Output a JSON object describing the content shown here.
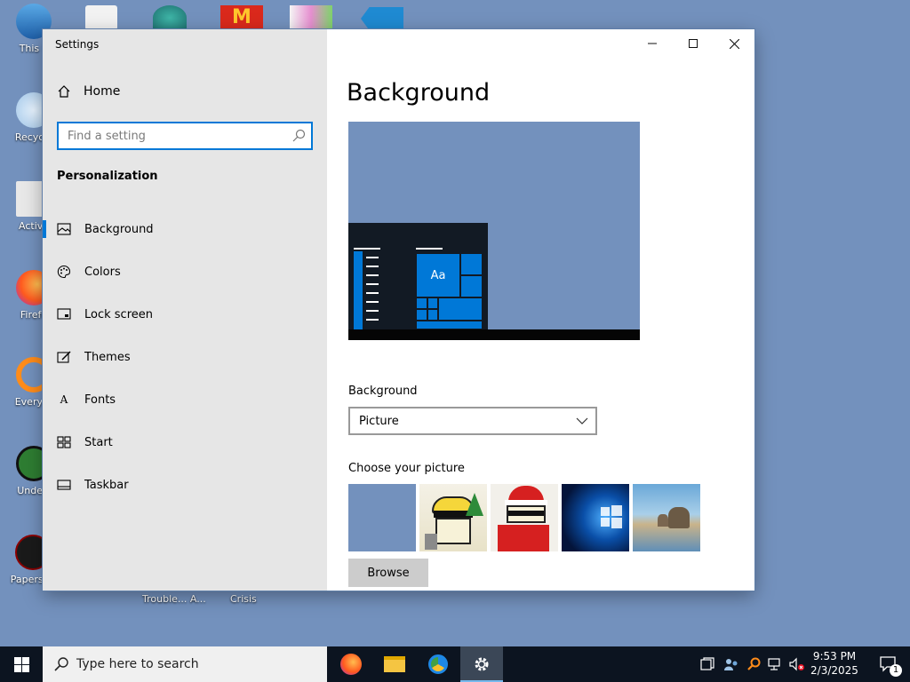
{
  "desktop": {
    "icons": [
      {
        "label": "This P"
      },
      {
        "label": "Recycle"
      },
      {
        "label": "Activa"
      },
      {
        "label": "Firefo"
      },
      {
        "label": "Everyth"
      },
      {
        "label": "Undert"
      },
      {
        "label": "Papers, P"
      }
    ],
    "labels_bottom": [
      "Trouble... A...",
      "Crisis"
    ]
  },
  "window": {
    "title": "Settings",
    "controls": {
      "minimize": "—",
      "maximize": "☐",
      "close": "✕"
    }
  },
  "sidebar": {
    "home_label": "Home",
    "search_placeholder": "Find a setting",
    "section_title": "Personalization",
    "items": [
      {
        "label": "Background",
        "icon": "picture-icon",
        "active": true
      },
      {
        "label": "Colors",
        "icon": "palette-icon",
        "active": false
      },
      {
        "label": "Lock screen",
        "icon": "lock-screen-icon",
        "active": false
      },
      {
        "label": "Themes",
        "icon": "themes-icon",
        "active": false
      },
      {
        "label": "Fonts",
        "icon": "fonts-icon",
        "active": false
      },
      {
        "label": "Start",
        "icon": "start-icon",
        "active": false
      },
      {
        "label": "Taskbar",
        "icon": "taskbar-icon",
        "active": false
      }
    ]
  },
  "main": {
    "page_title": "Background",
    "preview_sample_text": "Aa",
    "background_label": "Background",
    "background_value": "Picture",
    "choose_picture_label": "Choose your picture",
    "browse_label": "Browse"
  },
  "taskbar": {
    "search_placeholder": "Type here to search",
    "time": "9:53 PM",
    "date": "2/3/2025",
    "notification_count": "1"
  },
  "colors": {
    "accent": "#0078d7",
    "desktop": "#7391bd",
    "taskbar": "#0c1420"
  }
}
